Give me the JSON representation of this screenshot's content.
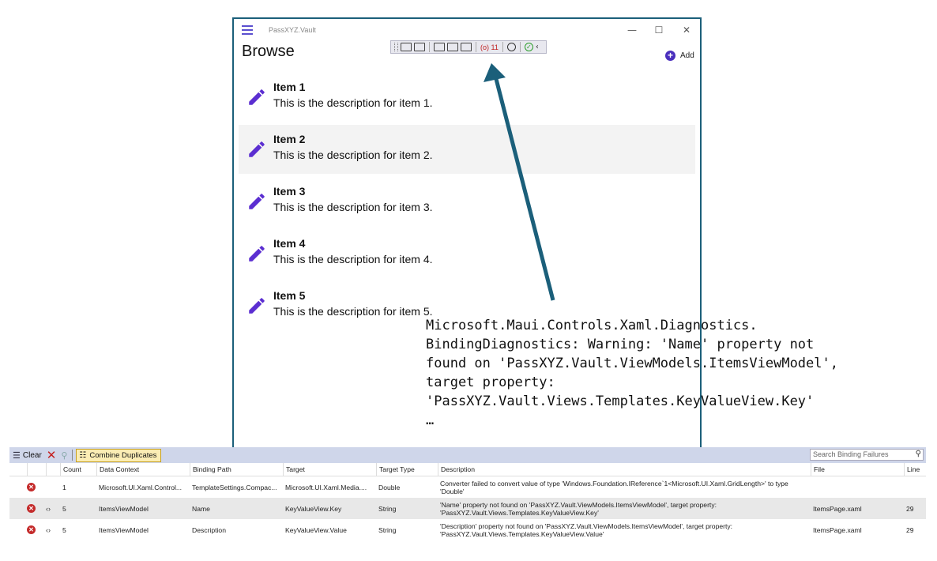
{
  "app": {
    "title": "PassXYZ.Vault",
    "page_title": "Browse",
    "add_label": "Add",
    "min_glyph": "—",
    "max_glyph": "☐",
    "close_glyph": "✕",
    "accent_color": "#5b2ed1",
    "items": [
      {
        "name": "Item 1",
        "description": "This is the description for item 1.",
        "icon": "pencil-icon"
      },
      {
        "name": "Item 2",
        "description": "This is the description for item 2.",
        "icon": "pencil-icon"
      },
      {
        "name": "Item 3",
        "description": "This is the description for item 3.",
        "icon": "pencil-icon"
      },
      {
        "name": "Item 4",
        "description": "This is the description for item 4.",
        "icon": "pencil-icon"
      },
      {
        "name": "Item 5",
        "description": "This is the description for item 5.",
        "icon": "pencil-icon"
      }
    ]
  },
  "debug_toolbar": {
    "binding_failures_count": "(o) 11",
    "check_glyph": "✓",
    "chevron_glyph": "‹"
  },
  "annotation": {
    "text": "Microsoft.Maui.Controls.Xaml.Diagnostics.\nBindingDiagnostics: Warning: 'Name' property not\nfound on 'PassXYZ.Vault.ViewModels.ItemsViewModel',\ntarget property:\n'PassXYZ.Vault.Views.Templates.KeyValueView.Key'\n…"
  },
  "binding_panel": {
    "clear_label": "Clear",
    "combine_label": "Combine Duplicates",
    "search_placeholder": "Search Binding Failures",
    "columns": {
      "count": "Count",
      "data_context": "Data Context",
      "binding_path": "Binding Path",
      "target": "Target",
      "target_type": "Target Type",
      "description": "Description",
      "file": "File",
      "line": "Line"
    },
    "rows": [
      {
        "link": "",
        "count": "1",
        "data_context": "Microsoft.UI.Xaml.Control...",
        "binding_path": "TemplateSettings.Compac...",
        "target": "Microsoft.UI.Xaml.Media....",
        "target_type": "Double",
        "description": "Converter failed to convert value of type 'Windows.Foundation.IReference`1<Microsoft.UI.Xaml.GridLength>' to type 'Double'",
        "file": "",
        "line": ""
      },
      {
        "link": "‹›",
        "count": "5",
        "data_context": "ItemsViewModel",
        "binding_path": "Name",
        "target": "KeyValueView.Key",
        "target_type": "String",
        "description": "'Name' property not found on 'PassXYZ.Vault.ViewModels.ItemsViewModel', target property: 'PassXYZ.Vault.Views.Templates.KeyValueView.Key'",
        "file": "ItemsPage.xaml",
        "line": "29"
      },
      {
        "link": "‹›",
        "count": "5",
        "data_context": "ItemsViewModel",
        "binding_path": "Description",
        "target": "KeyValueView.Value",
        "target_type": "String",
        "description": "'Description' property not found on 'PassXYZ.Vault.ViewModels.ItemsViewModel', target property: 'PassXYZ.Vault.Views.Templates.KeyValueView.Value'",
        "file": "ItemsPage.xaml",
        "line": "29"
      }
    ]
  }
}
